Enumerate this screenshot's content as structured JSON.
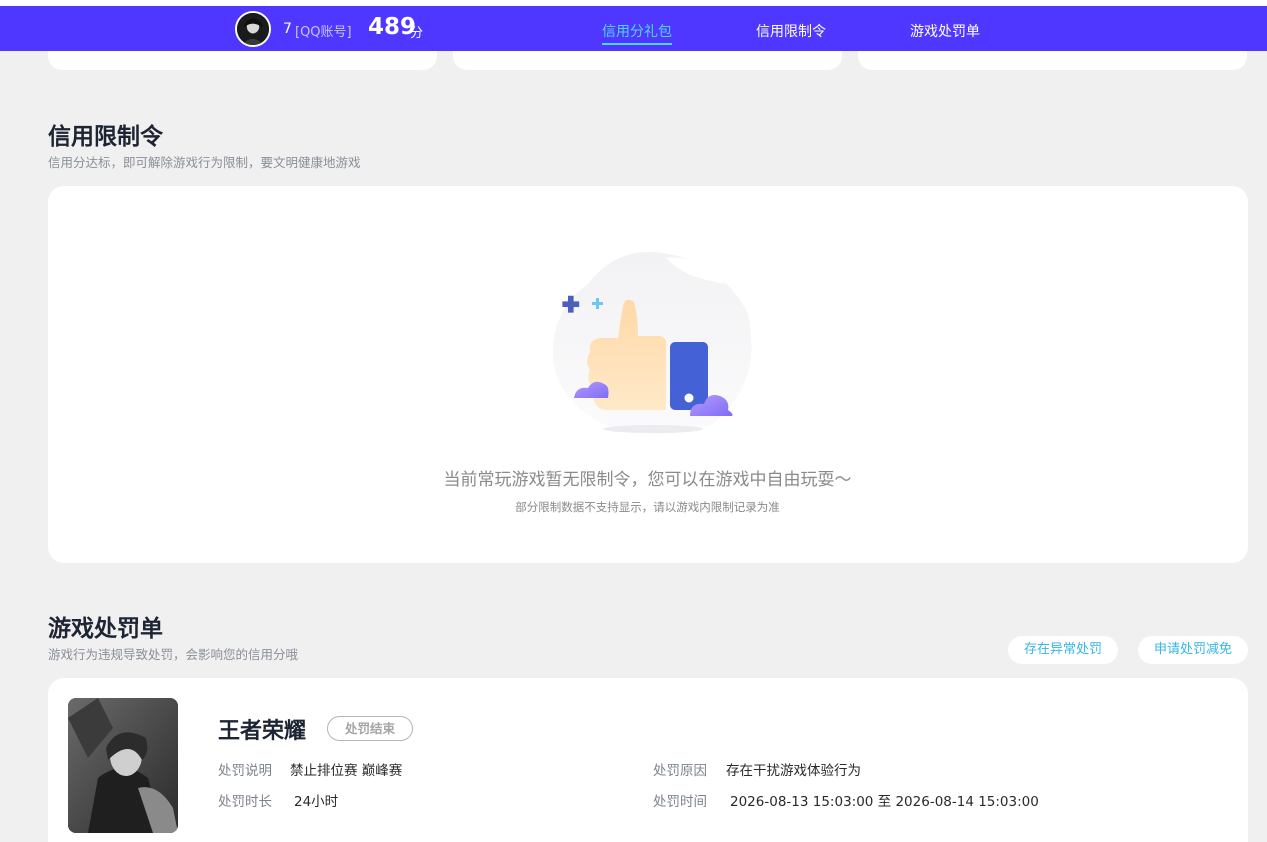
{
  "header": {
    "user_name": "7",
    "account_type": "[QQ账号]",
    "score": "489",
    "score_unit": "分",
    "tabs": [
      {
        "label": "信用分礼包",
        "active": true
      },
      {
        "label": "信用限制令",
        "active": false
      },
      {
        "label": "游戏处罚单",
        "active": false
      }
    ]
  },
  "restriction_section": {
    "title": "信用限制令",
    "subtitle": "信用分达标，即可解除游戏行为限制，要文明健康地游戏",
    "empty_title": "当前常玩游戏暂无限制令，您可以在游戏中自由玩耍～",
    "empty_note": "部分限制数据不支持显示，请以游戏内限制记录为准",
    "illustration_icon": "thumbs-up-icon"
  },
  "penalty_section": {
    "title": "游戏处罚单",
    "subtitle": "游戏行为违规导致处罚，会影响您的信用分哦",
    "buttons": [
      "存在异常处罚",
      "申请处罚减免"
    ],
    "records": [
      {
        "game_name": "王者荣耀",
        "status": "处罚结束",
        "fields": {
          "desc_label": "处罚说明",
          "desc_value": "禁止排位赛 巅峰赛",
          "reason_label": "处罚原因",
          "reason_value": "存在干扰游戏体验行为",
          "duration_label": "处罚时长",
          "duration_value": "24小时",
          "time_label": "处罚时间",
          "time_value": "2026-08-13 15:03:00 至 2026-08-14 15:03:00"
        }
      }
    ]
  },
  "colors": {
    "header_bg": "#4f37ff",
    "tab_active": "#4dd7ff",
    "link_blue": "#35b6e3",
    "page_bg": "#f0f0f0"
  }
}
